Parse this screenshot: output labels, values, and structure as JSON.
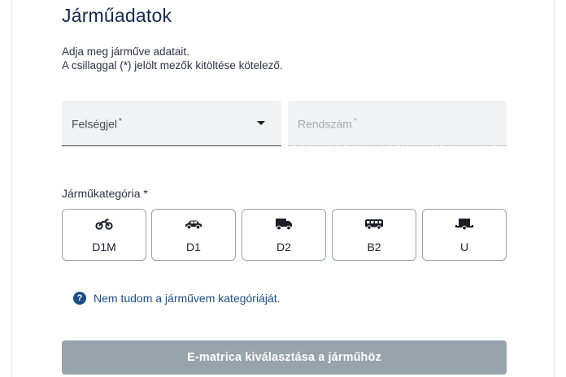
{
  "heading": "Járműadatok",
  "intro": {
    "line1": "Adja meg járműve adatait.",
    "line2": "A csillaggal (*) jelölt mezők kitöltése kötelező."
  },
  "country_field": {
    "label": "Felségjel",
    "required_mark": "*"
  },
  "plate_field": {
    "label": "Rendszám",
    "required_mark": "*"
  },
  "category": {
    "label": "Járműkategória *",
    "options": [
      {
        "code": "D1M",
        "icon": "motorcycle-icon"
      },
      {
        "code": "D1",
        "icon": "car-icon"
      },
      {
        "code": "D2",
        "icon": "van-icon"
      },
      {
        "code": "B2",
        "icon": "bus-icon"
      },
      {
        "code": "U",
        "icon": "trailer-icon"
      }
    ]
  },
  "help_link": {
    "icon": "question-icon",
    "icon_glyph": "?",
    "text": "Nem tudom a járművem kategóriáját."
  },
  "submit_button": {
    "label": "E-matrica kiválasztása a járműhöz"
  },
  "colors": {
    "heading": "#14284b",
    "link": "#1d4d82",
    "button_disabled": "#98a4ac",
    "field_bg": "#f1f2f4"
  }
}
